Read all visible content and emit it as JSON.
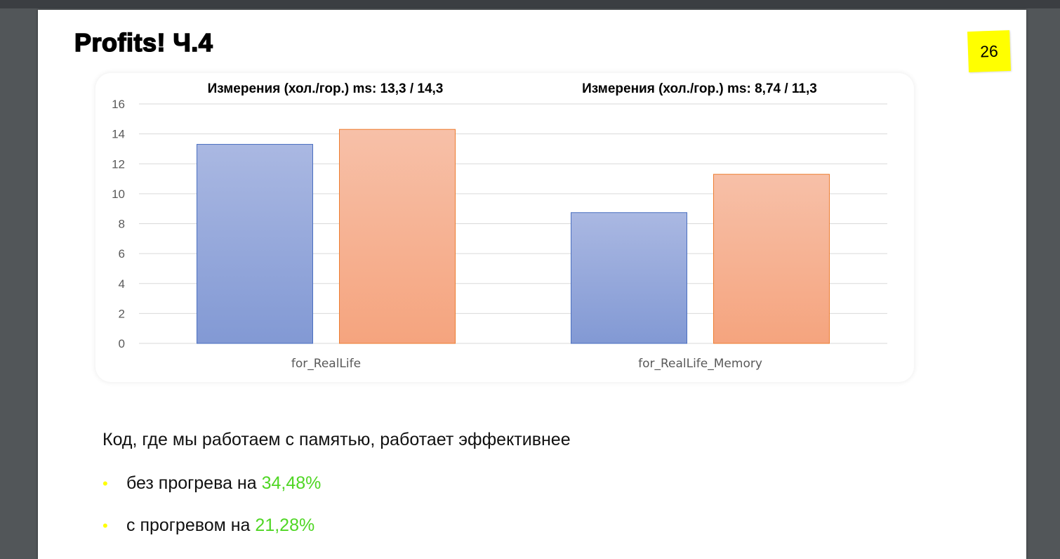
{
  "slide": {
    "title": "Profits!  Ч.4",
    "page_number": "26"
  },
  "chart_data": {
    "type": "bar",
    "categories": [
      "for_RealLife",
      "for_RealLife_Memory"
    ],
    "series": [
      {
        "values": [
          13.3,
          8.74
        ],
        "color": "#8ea3d8"
      },
      {
        "values": [
          14.3,
          11.3
        ],
        "color": "#f4a884"
      }
    ],
    "annotations": [
      "Измерения (хол./гор.) ms: 13,3 / 14,3",
      "Измерения (хол./гор.) ms: 8,74 / 11,3"
    ],
    "ylim": [
      0,
      16
    ],
    "yticks": [
      0,
      2,
      4,
      6,
      8,
      10,
      12,
      14,
      16
    ],
    "grid": true,
    "colors": {
      "blue_top": "#aab8e2",
      "blue_bottom": "#8299d4",
      "blue_edge": "#4a6fc0",
      "orange_top": "#f7c0a8",
      "orange_bottom": "#f5a47e",
      "orange_edge": "#ed7d31",
      "grid": "#d9d9d9",
      "tick_text": "#595959"
    }
  },
  "text": {
    "lead": "Код, где мы работаем с памятью, работает эффективнее",
    "bullets": [
      {
        "marker": "•",
        "prefix": "без прогрева на ",
        "highlight": "34,48%"
      },
      {
        "marker": "•",
        "prefix": "с прогревом на ",
        "highlight": "21,28%"
      }
    ],
    "highlight_color": "#4fd624"
  }
}
